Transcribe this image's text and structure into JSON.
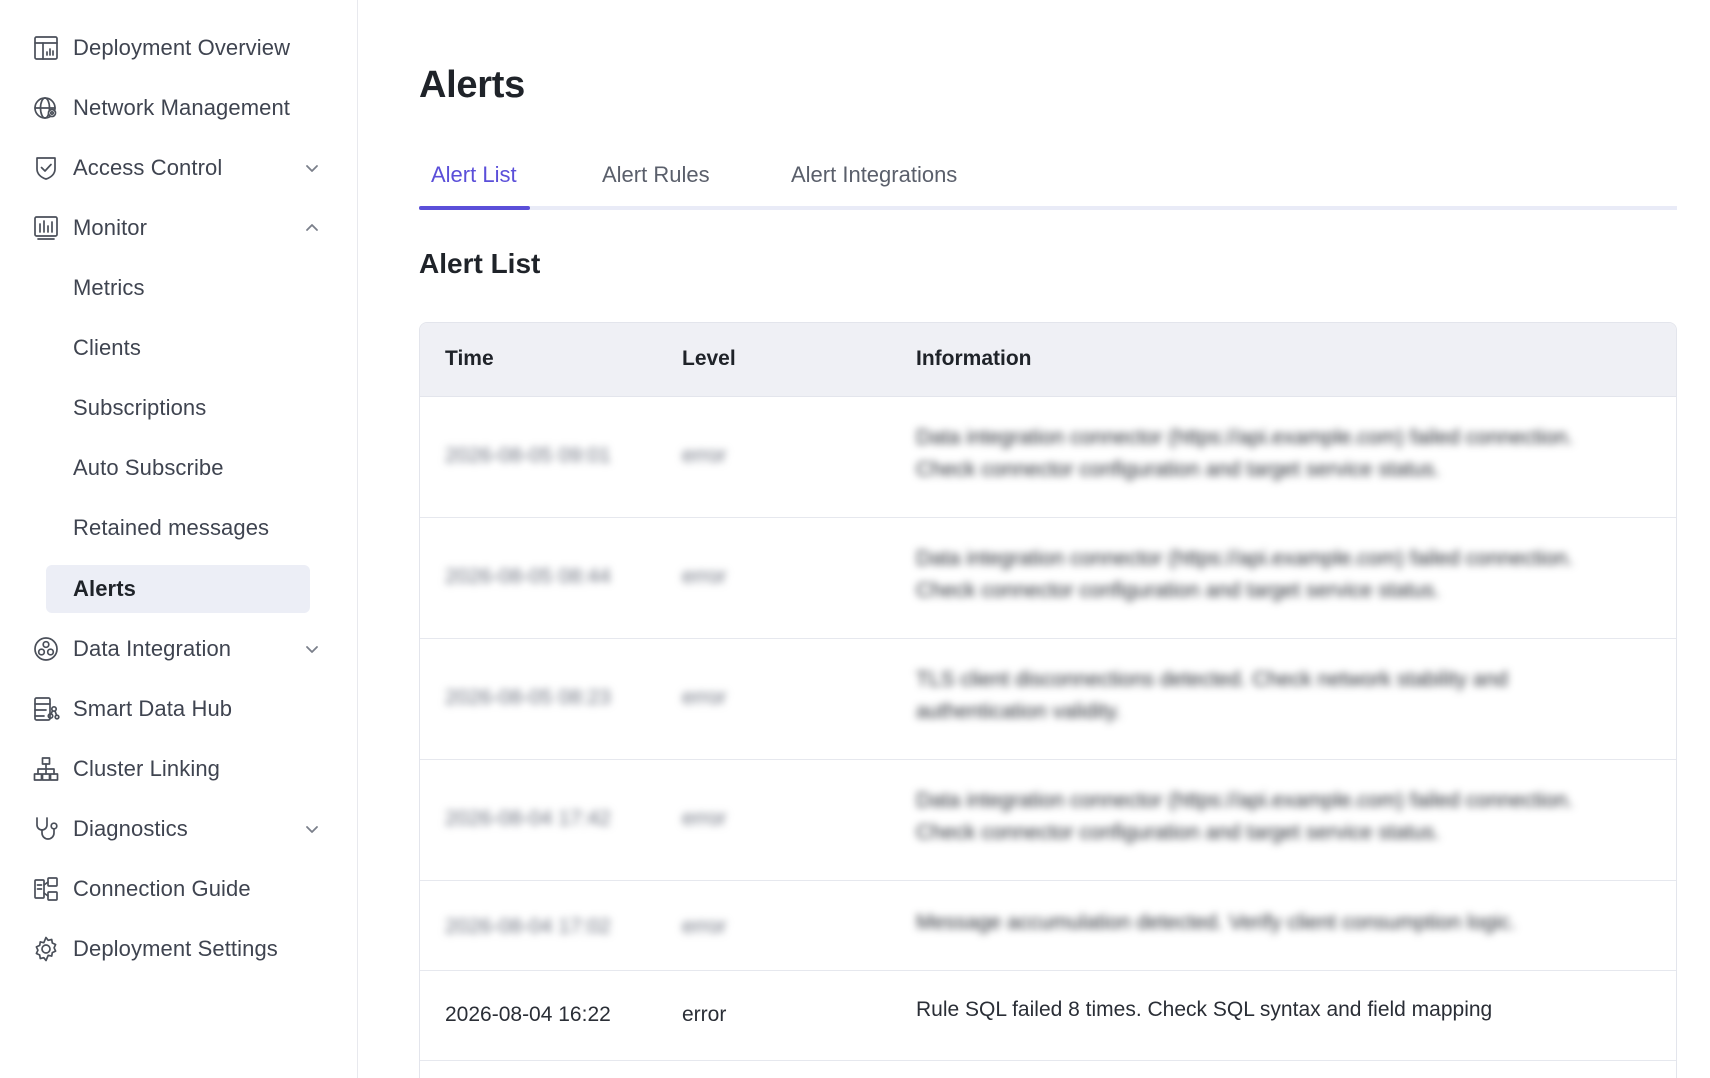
{
  "sidebar": {
    "items": [
      {
        "label": "Deployment Overview",
        "icon": "dashboard-icon"
      },
      {
        "label": "Network Management",
        "icon": "globe-gear-icon"
      },
      {
        "label": "Access Control",
        "icon": "shield-check-icon",
        "chevron": "down"
      },
      {
        "label": "Monitor",
        "icon": "bar-chart-icon",
        "chevron": "up"
      },
      {
        "label": "Data Integration",
        "icon": "integration-icon",
        "chevron": "down"
      },
      {
        "label": "Smart Data Hub",
        "icon": "data-hub-icon"
      },
      {
        "label": "Cluster Linking",
        "icon": "hierarchy-icon"
      },
      {
        "label": "Diagnostics",
        "icon": "stethoscope-icon",
        "chevron": "down"
      },
      {
        "label": "Connection Guide",
        "icon": "connection-icon"
      },
      {
        "label": "Deployment Settings",
        "icon": "gear-icon"
      }
    ],
    "monitor_sub": [
      "Metrics",
      "Clients",
      "Subscriptions",
      "Auto Subscribe",
      "Retained messages",
      "Alerts"
    ],
    "active_sub": "Alerts"
  },
  "main": {
    "title": "Alerts",
    "tabs": [
      "Alert List",
      "Alert Rules",
      "Alert Integrations"
    ],
    "active_tab": "Alert List",
    "section_title": "Alert List",
    "table": {
      "columns": [
        "Time",
        "Level",
        "Information"
      ],
      "rows": [
        {
          "time": "2026-08-05 09:01",
          "level": "error",
          "info": "Data integration connector (https://api.example.com) failed connection. Check connector configuration and target service status.",
          "blurred": true
        },
        {
          "time": "2026-08-05 08:44",
          "level": "error",
          "info": "Data integration connector (https://api.example.com) failed connection. Check connector configuration and target service status.",
          "blurred": true
        },
        {
          "time": "2026-08-05 08:23",
          "level": "error",
          "info": "TLS client disconnections detected. Check network stability and authentication validity.",
          "blurred": true
        },
        {
          "time": "2026-08-04 17:42",
          "level": "error",
          "info": "Data integration connector (https://api.example.com) failed connection. Check connector configuration and target service status.",
          "blurred": true
        },
        {
          "time": "2026-08-04 17:02",
          "level": "error",
          "info": "Message accumulation detected. Verify client consumption logic.",
          "blurred": true
        },
        {
          "time": "2026-08-04 16:22",
          "level": "error",
          "info": "Rule SQL failed 8 times. Check SQL syntax and field mapping",
          "blurred": false
        }
      ]
    }
  },
  "colors": {
    "accent": "#5b4fd9",
    "active_bg": "#eceef6",
    "table_header_bg": "#eff0f5"
  }
}
